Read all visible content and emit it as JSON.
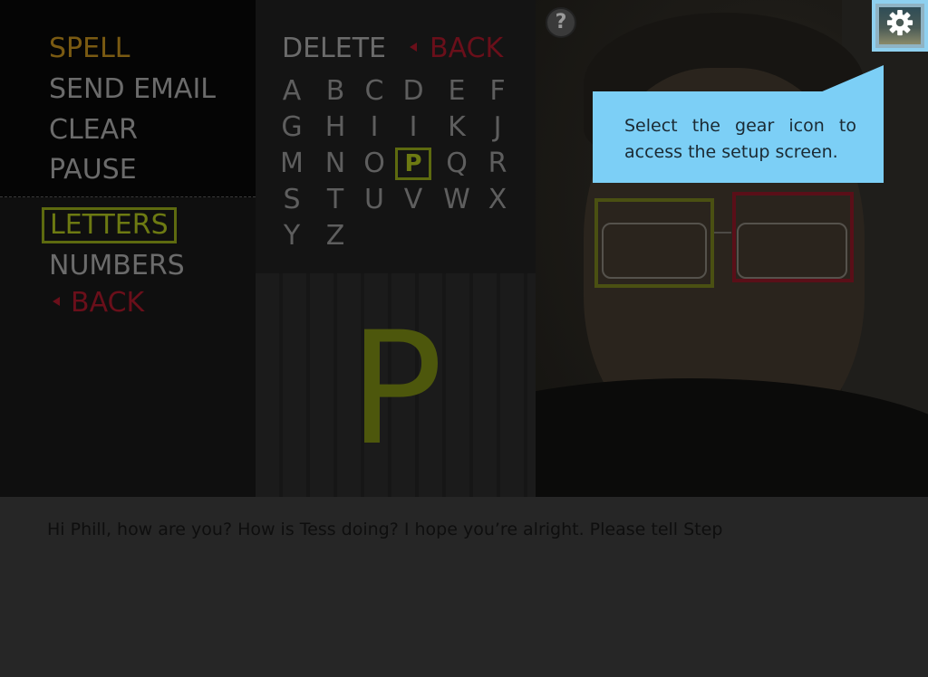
{
  "menu": {
    "commands": [
      {
        "label": "SPELL",
        "state": "active"
      },
      {
        "label": "SEND EMAIL",
        "state": "normal"
      },
      {
        "label": "CLEAR",
        "state": "normal"
      },
      {
        "label": "PAUSE",
        "state": "normal"
      }
    ],
    "modes": [
      {
        "label": "LETTERS",
        "state": "selected"
      },
      {
        "label": "NUMBERS",
        "state": "normal"
      },
      {
        "label": "BACK",
        "state": "back"
      }
    ]
  },
  "keyboard": {
    "delete_label": "DELETE",
    "back_label": "BACK",
    "rows": [
      [
        "A",
        "B",
        "C",
        "D",
        "E",
        "F"
      ],
      [
        "G",
        "H",
        "I",
        "I",
        "K",
        "J"
      ],
      [
        "M",
        "N",
        "O",
        "P",
        "Q",
        "R"
      ],
      [
        "S",
        "T",
        "U",
        "V",
        "W",
        "X"
      ],
      [
        "Y",
        "Z"
      ]
    ],
    "selected_key": "P",
    "current_letter": "P"
  },
  "help": {
    "symbol": "?"
  },
  "settings": {
    "icon": "gear-icon"
  },
  "tooltip": {
    "text": "Select the gear icon to access the setup screen."
  },
  "message": {
    "text": "Hi Phill, how are you? How is Tess doing? I hope you’re alright. Please tell Step"
  },
  "colors": {
    "selection": "#5d6a0f",
    "active_command": "#7a5a12",
    "back": "#6a0f1a",
    "tooltip": "#7ccff6",
    "left_eye_box": "#4a5012",
    "right_eye_box": "#5a0f18"
  }
}
